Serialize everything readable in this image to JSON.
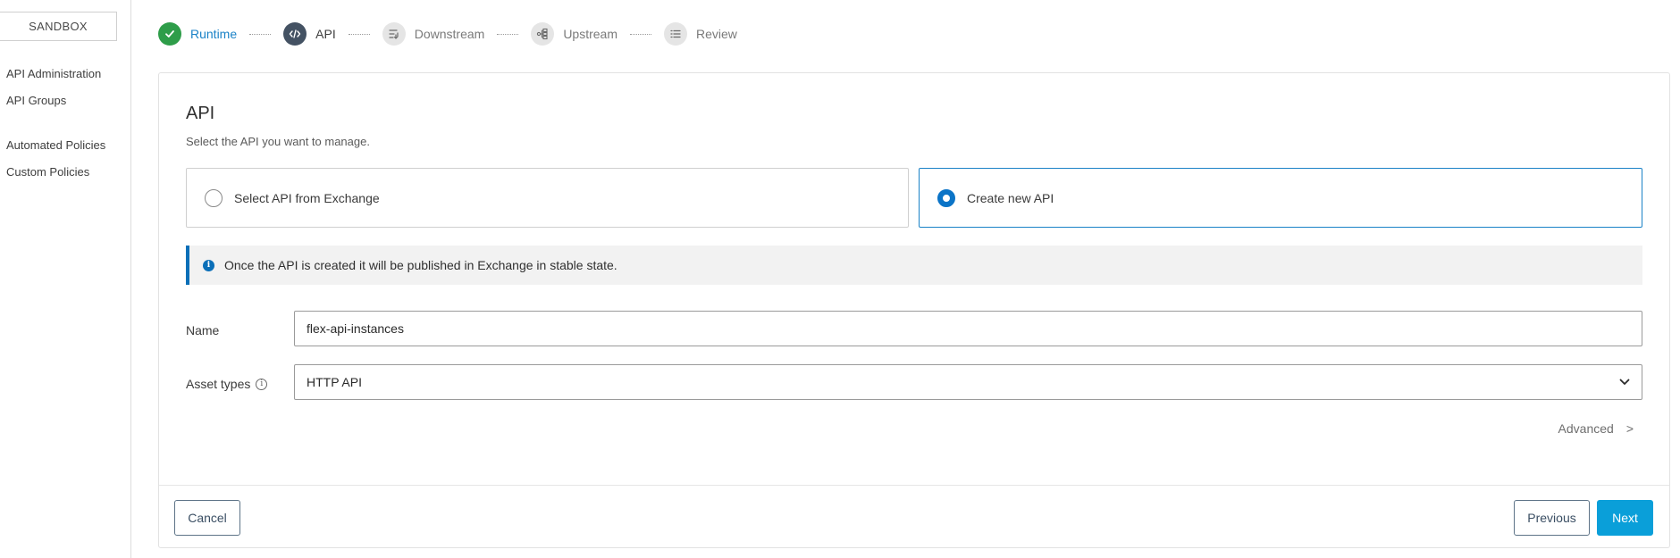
{
  "sidebar": {
    "environment": "SANDBOX",
    "items": [
      {
        "label": "API Administration"
      },
      {
        "label": "API Groups"
      },
      {
        "label": "Automated Policies"
      },
      {
        "label": "Custom Policies"
      }
    ]
  },
  "stepper": {
    "steps": [
      {
        "label": "Runtime",
        "state": "done",
        "icon": "check-icon"
      },
      {
        "label": "API",
        "state": "active",
        "icon": "code-icon"
      },
      {
        "label": "Downstream",
        "state": "pending",
        "icon": "downstream-icon"
      },
      {
        "label": "Upstream",
        "state": "pending",
        "icon": "upstream-icon"
      },
      {
        "label": "Review",
        "state": "pending",
        "icon": "list-icon"
      }
    ]
  },
  "card": {
    "title": "API",
    "subtitle": "Select the API you want to manage.",
    "options": [
      {
        "label": "Select API from Exchange",
        "selected": false
      },
      {
        "label": "Create new API",
        "selected": true
      }
    ],
    "info": "Once the API is created it will be published in Exchange in stable state.",
    "name_label": "Name",
    "name_value": "flex-api-instances",
    "asset_label": "Asset types",
    "asset_value": "HTTP API",
    "advanced_label": "Advanced",
    "advanced_chevron": ">"
  },
  "footer": {
    "cancel_label": "Cancel",
    "previous_label": "Previous",
    "next_label": "Next"
  },
  "colors": {
    "accent": "#0a9fd9",
    "link": "#1a82c7",
    "success": "#2e9d49",
    "info": "#0b6fb8"
  }
}
